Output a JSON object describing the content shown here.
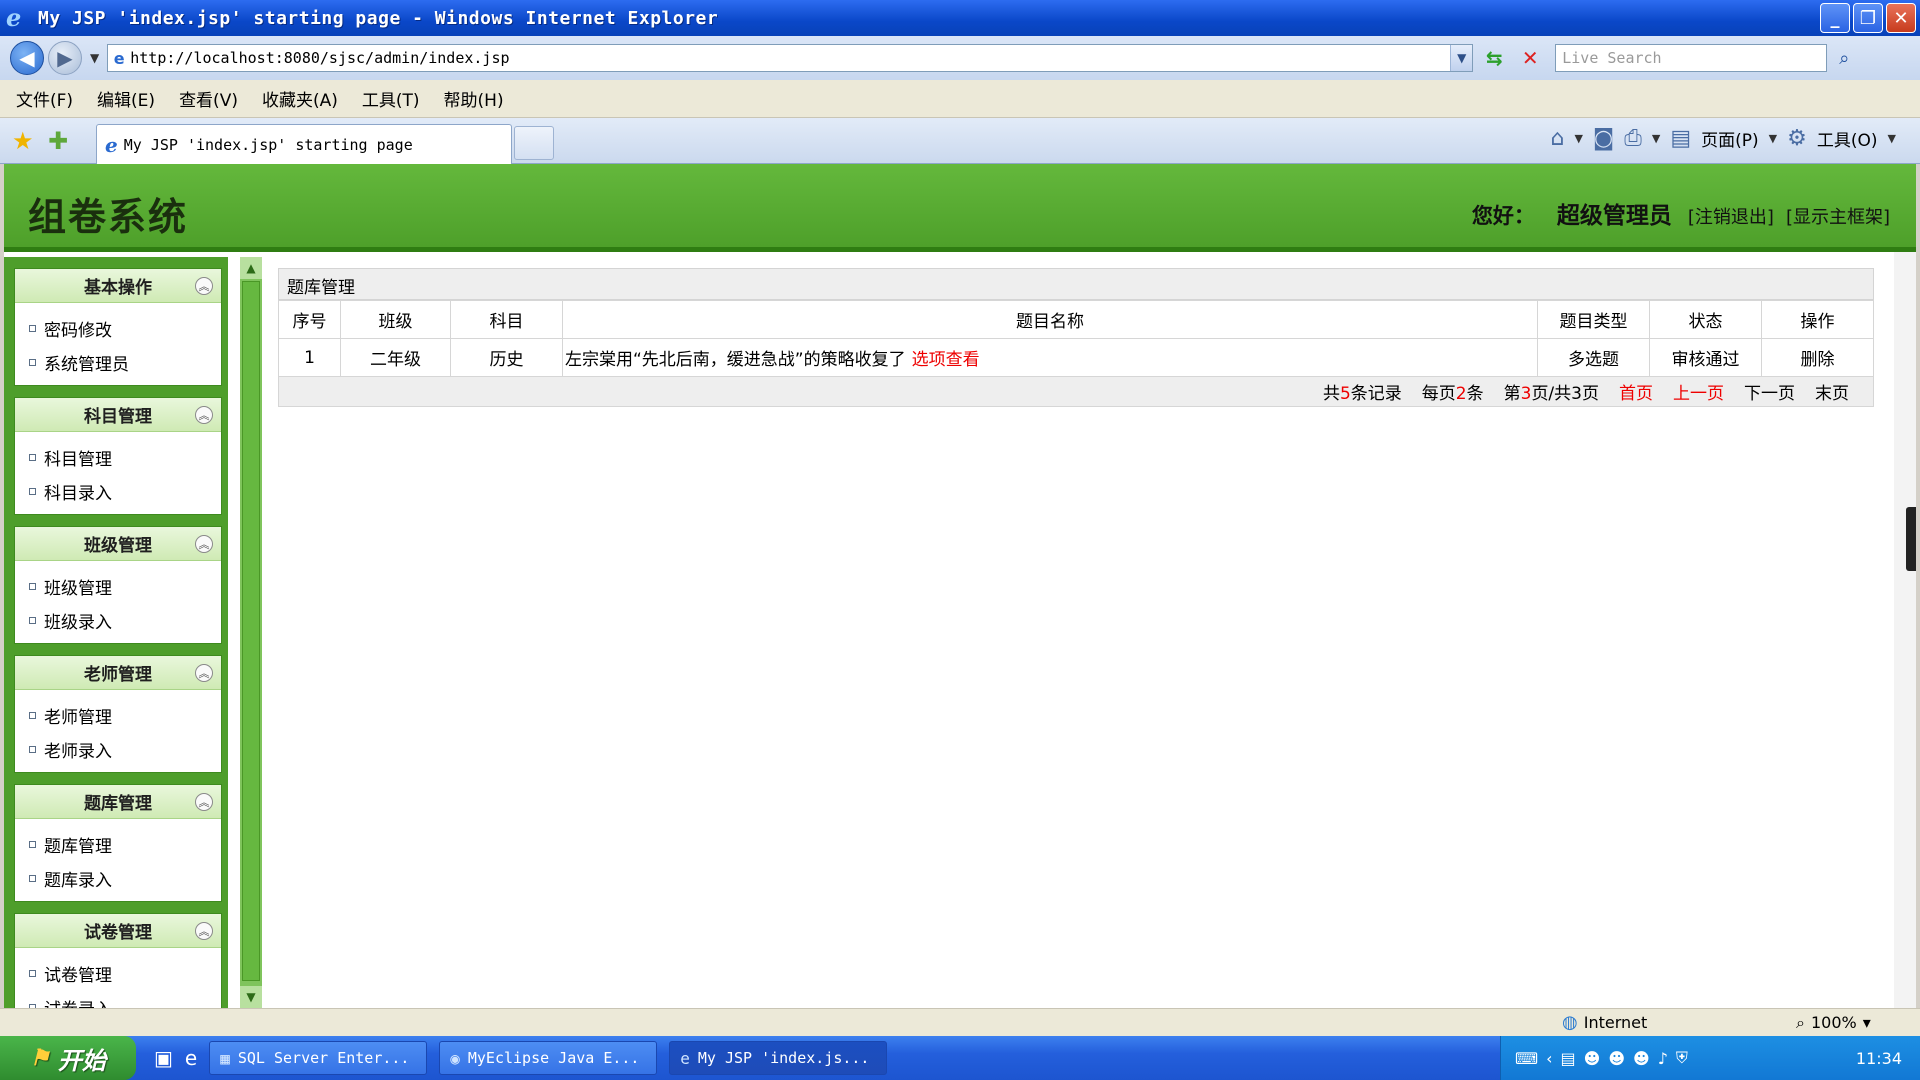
{
  "window": {
    "title": "My JSP 'index.jsp' starting page - Windows Internet Explorer",
    "buttons": [
      "_",
      "❐",
      "✕"
    ]
  },
  "address_bar": {
    "url": "http://localhost:8080/sjsc/admin/index.jsp",
    "search_placeholder": "Live Search"
  },
  "menu": [
    "文件(F)",
    "编辑(E)",
    "查看(V)",
    "收藏夹(A)",
    "工具(T)",
    "帮助(H)"
  ],
  "tab": {
    "label": "My JSP 'index.jsp' starting page"
  },
  "command_bar": {
    "page": "页面(P)",
    "tools": "工具(O)"
  },
  "header": {
    "system_title": "组卷系统",
    "greeting": "您好：",
    "user": "超级管理员",
    "logout": "[注销退出]",
    "show_frame": "[显示主框架]"
  },
  "sidebar": {
    "groups": [
      {
        "title": "基本操作",
        "items": [
          "密码修改",
          "系统管理员"
        ]
      },
      {
        "title": "科目管理",
        "items": [
          "科目管理",
          "科目录入"
        ]
      },
      {
        "title": "班级管理",
        "items": [
          "班级管理",
          "班级录入"
        ]
      },
      {
        "title": "老师管理",
        "items": [
          "老师管理",
          "老师录入"
        ]
      },
      {
        "title": "题库管理",
        "items": [
          "题库管理",
          "题库录入"
        ]
      },
      {
        "title": "试卷管理",
        "items": [
          "试卷管理",
          "试卷录入"
        ]
      }
    ]
  },
  "main": {
    "panel_title": "题库管理",
    "columns": [
      "序号",
      "班级",
      "科目",
      "题目名称",
      "题目类型",
      "状态",
      "操作"
    ],
    "rows": [
      {
        "index": "1",
        "class": "二年级",
        "subject": "历史",
        "name": "左宗棠用“先北后南，缓进急战”的策略收复了",
        "view_link": "选项查看",
        "type": "多选题",
        "status": "审核通过",
        "action": "删除"
      }
    ],
    "pager": {
      "total_prefix": "共",
      "total": "5",
      "total_suffix": "条记录",
      "per_prefix": "每页",
      "per": "2",
      "per_suffix": "条",
      "page_prefix": "第",
      "page": "3",
      "page_mid": "页/共",
      "pages": "3",
      "page_suffix": "页",
      "first": "首页",
      "prev": "上一页",
      "next": "下一页",
      "last": "末页"
    }
  },
  "status_bar": {
    "zone": "Internet",
    "zoom": "100%"
  },
  "taskbar": {
    "start": "开始",
    "tasks": [
      "SQL Server Enter...",
      "MyEclipse Java E...",
      "My JSP 'index.js..."
    ],
    "clock": "11:34"
  },
  "colors": {
    "header_green": "#4ea02a",
    "sidebar_green": "#4e9e2b",
    "link_red": "#e00000",
    "ie_blue": "#0a47c8"
  }
}
